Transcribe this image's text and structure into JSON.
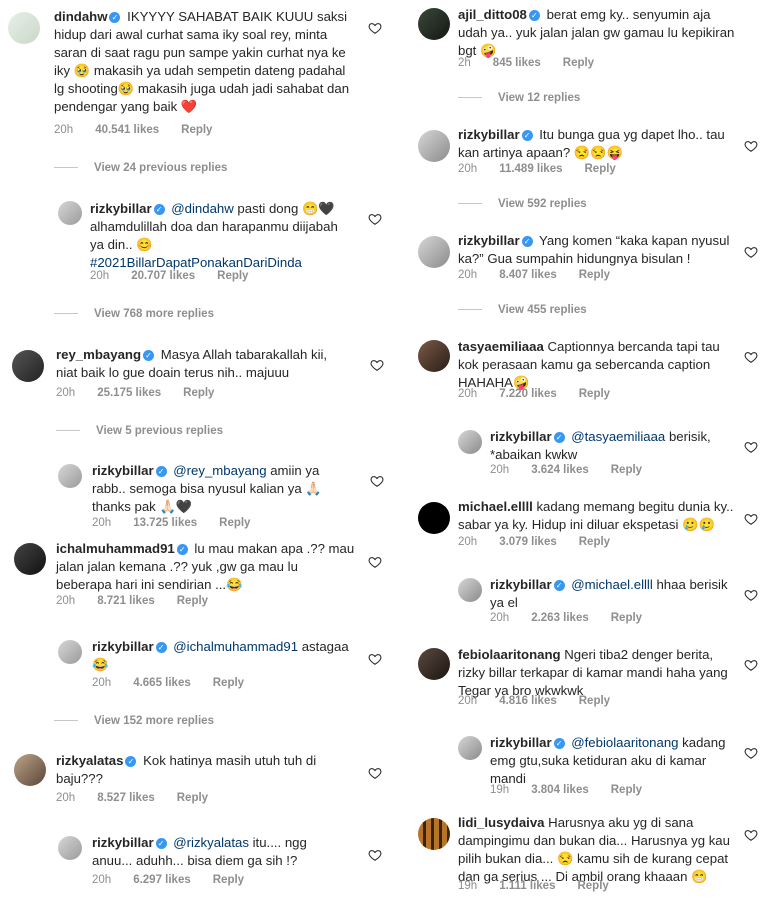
{
  "left": {
    "c1": {
      "user": "dindahw",
      "pre": "IKYYYY SAHABAT BAIK KUUU saksi hidup dari awal curhat sama iky soal rey, minta saran di saat ragu pun sampe yakin curhat nya ke iky 🥹 makasih ya udah sempetin dateng padahal lg shooting🥹 makasih juga udah jadi sahabat dan pendengar yang baik ❤️",
      "time": "20h",
      "likes": "40.541 likes",
      "reply": "Reply"
    },
    "v1": "View 24 previous replies",
    "r1": {
      "user": "rizkybillar",
      "tag": "@dindahw",
      "text": " pasti dong 😁🖤 alhamdulillah doa dan harapanmu diijabah ya din.. 😊",
      "hashtag": "#2021BillarDapatPonakanDariDinda",
      "time": "20h",
      "likes": "20.707 likes",
      "reply": "Reply"
    },
    "v2": "View 768 more replies",
    "c2": {
      "user": "rey_mbayang",
      "text": "Masya Allah tabarakallah kii, niat baik lo gue doain terus nih.. majuuu",
      "time": "20h",
      "likes": "25.175 likes",
      "reply": "Reply"
    },
    "v3": "View 5 previous replies",
    "r2": {
      "user": "rizkybillar",
      "tag": "@rey_mbayang",
      "text": " amiin ya rabb.. semoga bisa nyusul kalian ya 🙏🏻 thanks pak 🙏🏻🖤",
      "time": "20h",
      "likes": "13.725 likes",
      "reply": "Reply"
    },
    "c3": {
      "user": "ichalmuhammad91",
      "text": "lu mau makan apa .?? mau jalan jalan kemana .?? yuk ,gw ga mau lu beberapa hari ini sendirian ...😂",
      "time": "20h",
      "likes": "8.721 likes",
      "reply": "Reply"
    },
    "r3": {
      "user": "rizkybillar",
      "tag": "@ichalmuhammad91",
      "text": " astagaa 😂",
      "time": "20h",
      "likes": "4.665 likes",
      "reply": "Reply"
    },
    "v4": "View 152 more replies",
    "c4": {
      "user": "rizkyalatas",
      "text": "Kok hatinya masih utuh tuh di baju???",
      "time": "20h",
      "likes": "8.527 likes",
      "reply": "Reply"
    },
    "r4": {
      "user": "rizkybillar",
      "tag": "@rizkyalatas",
      "text": " itu.... ngg anuu... aduhh... bisa diem ga sih !?",
      "time": "20h",
      "likes": "6.297 likes",
      "reply": "Reply"
    }
  },
  "right": {
    "c1": {
      "user": "ajil_ditto08",
      "text": "berat emg ky.. senyumin aja udah ya.. yuk jalan jalan gw gamau lu kepikiran bgt 🤪",
      "time": "2h",
      "likes": "845 likes",
      "reply": "Reply"
    },
    "v1": "View 12 replies",
    "c2": {
      "user": "rizkybillar",
      "text": "Itu bunga gua yg dapet lho.. tau kan artinya apaan? 😒😒😝",
      "time": "20h",
      "likes": "11.489 likes",
      "reply": "Reply"
    },
    "v2": "View 592 replies",
    "c3": {
      "user": "rizkybillar",
      "text": "Yang komen “kaka kapan nyusul ka?” Gua sumpahin hidungnya bisulan !",
      "time": "20h",
      "likes": "8.407 likes",
      "reply": "Reply"
    },
    "v3": "View 455 replies",
    "c4": {
      "user": "tasyaemiliaaa",
      "text": "Captionnya bercanda tapi tau kok perasaan kamu ga sebercanda caption HAHAHA🤪",
      "time": "20h",
      "likes": "7.220 likes",
      "reply": "Reply"
    },
    "r1": {
      "user": "rizkybillar",
      "tag": "@tasyaemiliaaa",
      "text": " berisik, *abaikan kwkw",
      "time": "20h",
      "likes": "3.624 likes",
      "reply": "Reply"
    },
    "c5": {
      "user": "michael.ellll",
      "text": "kadang memang begitu dunia ky.. sabar ya ky. Hidup ini diluar ekspetasi 🥲🥲",
      "time": "20h",
      "likes": "3.079 likes",
      "reply": "Reply"
    },
    "r2": {
      "user": "rizkybillar",
      "tag": "@michael.ellll",
      "text": " hhaa berisik ya el",
      "time": "20h",
      "likes": "2.263 likes",
      "reply": "Reply"
    },
    "c6": {
      "user": "febiolaaritonang",
      "text": "Ngeri tiba2 denger berita, rizky billar terkapar di kamar mandi haha yang Tegar ya bro wkwkwk",
      "time": "20h",
      "likes": "4.816 likes",
      "reply": "Reply"
    },
    "r3": {
      "user": "rizkybillar",
      "tag": "@febiolaaritonang",
      "text": " kadang emg gtu,suka ketiduran aku di kamar mandi",
      "time": "19h",
      "likes": "3.804 likes",
      "reply": "Reply"
    },
    "c7": {
      "user": "lidi_lusydaiva",
      "text": "Harusnya aku yg di sana dampingimu dan bukan dia... Harusnya yg kau pilih bukan dia... 😒 kamu sih de kurang cepat dan ga serius ... Di ambil orang khaaan 😁",
      "time": "19h",
      "likes": "1.111 likes",
      "reply": "Reply"
    }
  },
  "icons": {
    "like": "heart-outline-icon",
    "verified": "verified-badge-icon"
  },
  "colors": {
    "verified": "#3897f0",
    "mention": "#00376b",
    "meta": "#8e8e8e"
  }
}
